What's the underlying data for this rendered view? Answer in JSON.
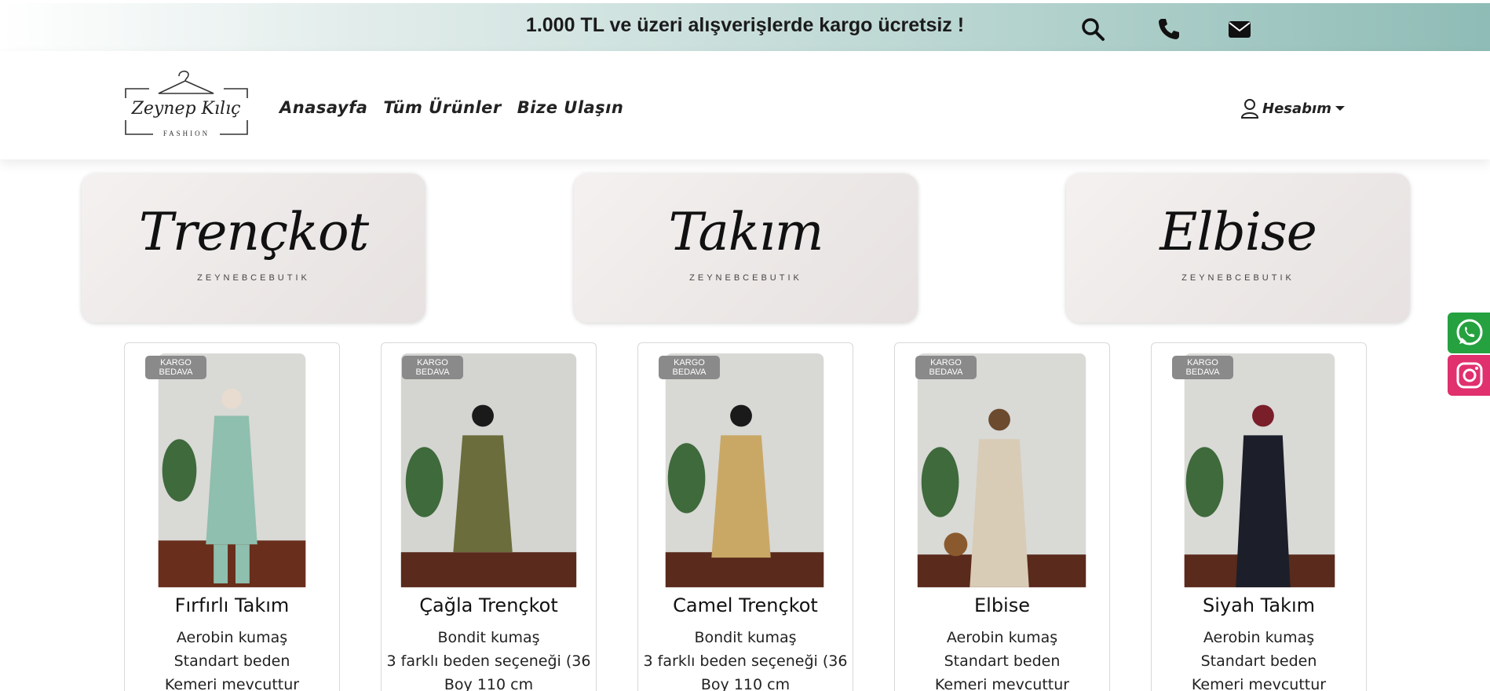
{
  "topbar": {
    "promo": "1.000 TL ve üzeri alışverişlerde kargo ücretsiz !",
    "icons": [
      "search-icon",
      "phone-icon",
      "mail-icon"
    ]
  },
  "header": {
    "logo": {
      "brand": "ZEYNEP KILIÇ",
      "sub": "FASHION"
    },
    "nav": [
      "Anasayfa",
      "Tüm Ürünler",
      "Bize Ulaşın"
    ],
    "account_label": "Hesabım"
  },
  "banners": [
    {
      "title": "Trençkot",
      "sub": "ZEYNEBCEBUTIK"
    },
    {
      "title": "Takım",
      "sub": "ZEYNEBCEBUTIK"
    },
    {
      "title": "Elbise",
      "sub": "ZEYNEBCEBUTIK"
    }
  ],
  "products": [
    {
      "badge": "KARGO BEDAVA",
      "title": "Fırfırlı Takım",
      "lines": [
        "Aerobin kumaş",
        "Standart beden",
        "Kemeri mevcuttur"
      ],
      "color": "#8fbfae"
    },
    {
      "badge": "KARGO BEDAVA",
      "title": "Çağla Trençkot",
      "lines": [
        "Bondit kumaş",
        "3 farklı beden seçeneği (36",
        "Boy 110 cm"
      ],
      "color": "#6b6e3c"
    },
    {
      "badge": "KARGO BEDAVA",
      "title": "Camel Trençkot",
      "lines": [
        "Bondit kumaş",
        "3 farklı beden seçeneği (36",
        "Boy 110 cm"
      ],
      "color": "#c9a866"
    },
    {
      "badge": "KARGO BEDAVA",
      "title": "Elbise",
      "lines": [
        "Aerobin kumaş",
        "Standart beden",
        "Kemeri mevcuttur"
      ],
      "color": "#d8ccb6"
    },
    {
      "badge": "KARGO BEDAVA",
      "title": "Siyah Takım",
      "lines": [
        "Aerobin kumaş",
        "Standart beden",
        "Kemeri mevcuttur"
      ],
      "color": "#1c1f2a"
    }
  ],
  "social": [
    {
      "icon": "whatsapp-icon",
      "color": "#25a140"
    },
    {
      "icon": "instagram-icon",
      "color": "#e0306e"
    }
  ],
  "colors": {
    "accent": "#8fbcb6"
  }
}
